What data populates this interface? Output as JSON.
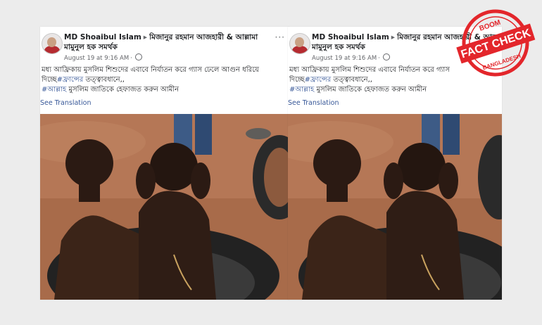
{
  "posts": [
    {
      "author_name": "MD Shoaibul Islam",
      "separator": "▸",
      "group_name_line1": "মিজানুর রহমান আজহারী & আল্লামা",
      "group_name_line2": "মামুনুল হক সমর্থক",
      "timestamp": "August 19 at 9:16 AM",
      "menu": "···",
      "text_line1": "মধ্য আফ্রিকায় মুসলিম শিশুদের এবাবে নির্যাতন করে গ্যাস ঢেলে আগুন ধরিয়ে",
      "text_line2_prefix": "দিচ্ছে",
      "text_line2_hash": "#ফ্রান্সের",
      "text_line2_suffix": " তত্ত্বাবধানে,,",
      "text_line3_hash": "#আল্লাহ",
      "text_line3_suffix": " মুসলিম জাতিকে হেফাজত করুন আমীন",
      "see_translation": "See Translation"
    },
    {
      "author_name": "MD Shoaibul Islam",
      "separator": "▸",
      "group_name_line1": "মিজানুর রহমান আজহারী & আল্",
      "group_name_line2": "মামুনুল হক সমর্থক",
      "timestamp": "August 19 at 9:16 AM",
      "menu": "",
      "text_line1": "মধ্য আফ্রিকায় মুসলিম শিশুদের এবাবে নির্যাতন করে গ্যাস",
      "text_line2_prefix": "দিচ্ছে",
      "text_line2_hash": "#ফ্রান্সের",
      "text_line2_suffix": " তত্ত্বাবধানে,,",
      "text_line3_hash": "#আল্লাহ",
      "text_line3_suffix": " মুসলিম জাতিকে হেফাজত করুন আমীন",
      "see_translation": "See Translation"
    }
  ],
  "badge": {
    "top_text": "BOOM",
    "main_text": "FACT CHECK",
    "bottom_text": "BANGLADESH",
    "color": "#e3262b"
  }
}
